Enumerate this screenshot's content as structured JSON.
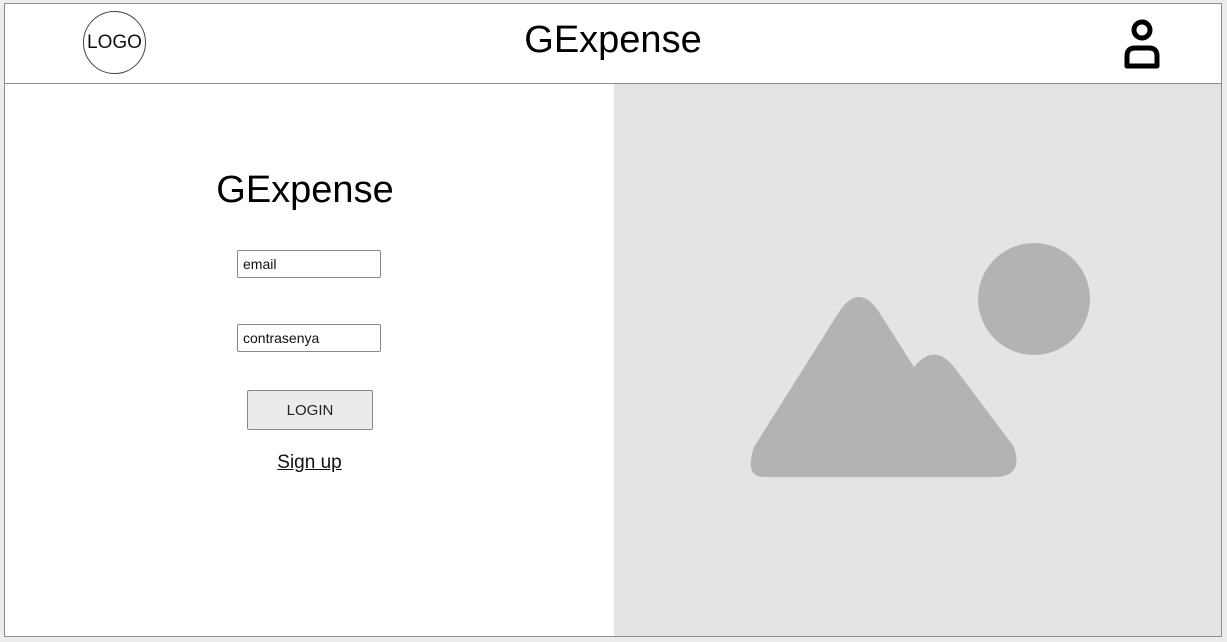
{
  "header": {
    "logo_label": "LOGO",
    "title": "GExpense",
    "user_icon": "user-icon"
  },
  "login_form": {
    "title": "GExpense",
    "email_placeholder": "email",
    "password_placeholder": "contrasenya",
    "login_label": "LOGIN",
    "signup_label": "Sign up"
  },
  "hero": {
    "image_icon": "image-placeholder-icon",
    "background_color": "#e4e4e4",
    "shape_color": "#b3b3b3"
  }
}
